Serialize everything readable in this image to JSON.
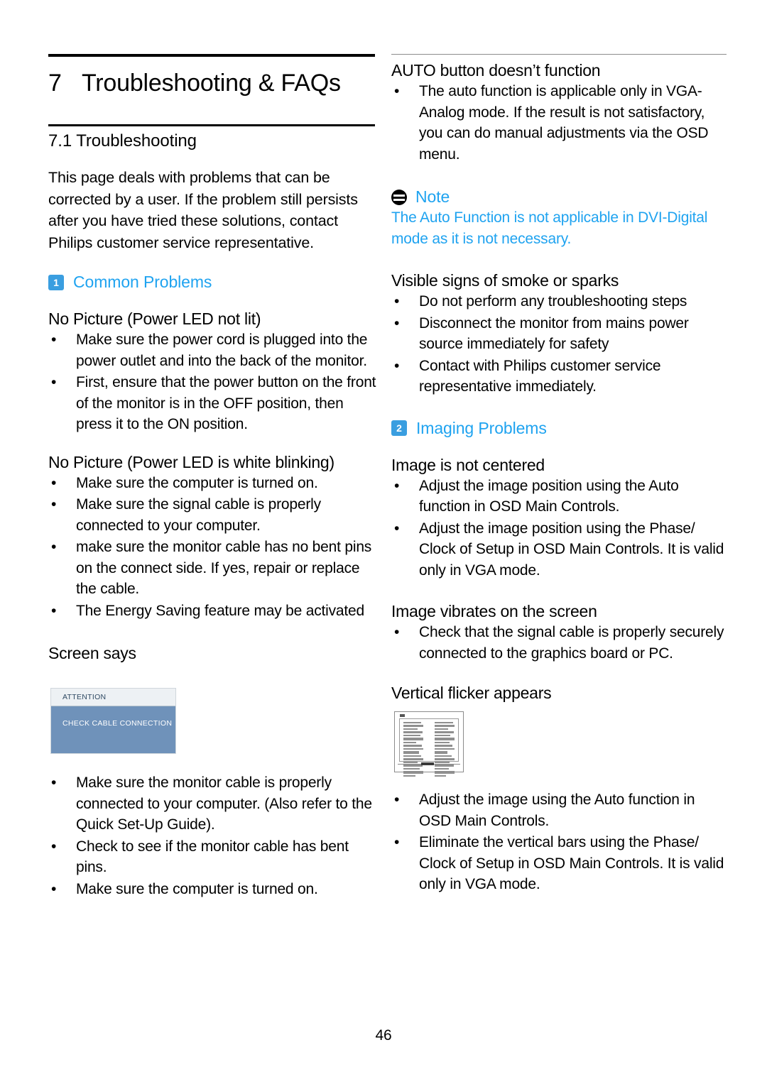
{
  "colors": {
    "accent_blue": "#1fa3f0",
    "badge_blue": "#3a9ee0",
    "osd_title_bg": "#edf1f4",
    "osd_body_bg": "#6f92ba",
    "rule_gray": "#8c8c8c"
  },
  "left_column": {
    "chapter": {
      "number": "7",
      "title": "Troubleshooting & FAQs"
    },
    "section": {
      "number_title": "7.1 Troubleshooting"
    },
    "intro": "This page deals with problems that can be corrected by a user. If the problem still persists after you have tried these solutions, contact Philips customer service representative.",
    "common_problems": {
      "badge": "1",
      "label": "Common Problems"
    },
    "groups": [
      {
        "heading": "No Picture (Power LED not lit)",
        "bullets": [
          "Make sure the power cord is plugged into the power outlet and into the back of the monitor.",
          "First, ensure that the power button on the front of the monitor is in the OFF position, then press it to the ON position."
        ]
      },
      {
        "heading": "No Picture (Power LED is white blinking)",
        "bullets": [
          "Make sure the computer is turned on.",
          "Make sure the signal cable is properly connected to your computer.",
          "make sure the monitor cable has no bent pins on the connect side. If yes, repair or replace the cable.",
          "The Energy Saving feature may be activated"
        ]
      }
    ],
    "screen_says": {
      "heading": "Screen says",
      "osd": {
        "title": "ATTENTION",
        "message": "CHECK CABLE CONNECTION"
      },
      "bullets": [
        "Make sure the monitor cable is properly connected to your computer. (Also refer to the Quick Set-Up Guide).",
        "Check to see if the monitor cable has bent pins.",
        "Make sure the computer is turned on."
      ]
    }
  },
  "right_column": {
    "auto_button": {
      "heading": "AUTO button doesn’t function",
      "bullets": [
        "The auto function is applicable only in VGA-Analog mode.  If the result is not satisfactory, you can do manual adjustments via the OSD menu."
      ]
    },
    "note": {
      "icon": "note-icon",
      "title": "Note",
      "body": "The Auto Function is not applicable in DVI-Digital mode as it is not necessary."
    },
    "smoke": {
      "heading": "Visible signs of smoke or sparks",
      "bullets": [
        "Do not perform any troubleshooting steps",
        "Disconnect the monitor from mains power source immediately for safety",
        "Contact with Philips customer service representative immediately."
      ]
    },
    "imaging_problems": {
      "badge": "2",
      "label": "Imaging Problems"
    },
    "groups": [
      {
        "heading": "Image is not centered",
        "bullets": [
          "Adjust the image position using the Auto function in OSD Main Controls.",
          "Adjust the image position using the Phase/ Clock of Setup in OSD Main Controls.  It is valid only in VGA mode."
        ]
      },
      {
        "heading": "Image vibrates on the screen",
        "bullets": [
          "Check that the signal cable is properly securely connected to the graphics board or PC."
        ]
      }
    ],
    "vertical_flicker": {
      "heading": "Vertical flicker appears",
      "figure_name": "vertical-flicker-thumbnail",
      "bullets": [
        "Adjust the image using the Auto function in OSD Main Controls.",
        "Eliminate the vertical bars using the Phase/ Clock of Setup in OSD Main Controls. It is valid only in VGA mode."
      ]
    }
  },
  "footer": {
    "page_number": "46"
  }
}
